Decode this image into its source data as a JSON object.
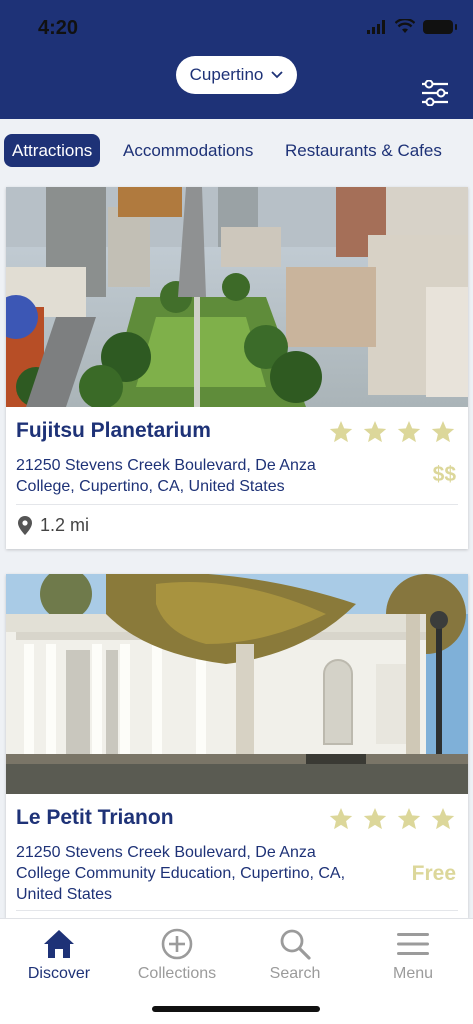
{
  "status": {
    "time": "4:20"
  },
  "header": {
    "city": "Cupertino"
  },
  "tabs": [
    {
      "label": "Attractions"
    },
    {
      "label": "Accommodations"
    },
    {
      "label": "Restaurants & Cafes"
    }
  ],
  "cards": [
    {
      "title": "Fujitsu Planetarium",
      "rating": 4,
      "address": "21250 Stevens Creek Boulevard, De Anza College, Cupertino, CA, United States",
      "price": "$$",
      "distance": "1.2 mi"
    },
    {
      "title": "Le Petit Trianon",
      "rating": 4,
      "address": "21250 Stevens Creek Boulevard, De Anza College Community Education, Cupertino, CA, United States",
      "price": "Free"
    }
  ],
  "tabbar": [
    {
      "label": "Discover",
      "icon": "home-icon"
    },
    {
      "label": "Collections",
      "icon": "plus-circle-icon"
    },
    {
      "label": "Search",
      "icon": "search-icon"
    },
    {
      "label": "Menu",
      "icon": "hamburger-icon"
    }
  ],
  "colors": {
    "brand": "#1e3277",
    "accent": "#dcd79a",
    "inactive": "#9b9b9b"
  }
}
